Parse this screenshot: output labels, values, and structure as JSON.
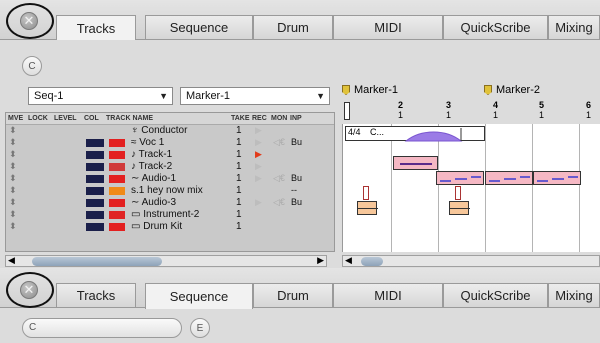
{
  "tabs_top": {
    "items": [
      "Tracks",
      "Sequence",
      "Drum",
      "MIDI",
      "QuickScribe",
      "Mixing"
    ],
    "active": "Tracks",
    "close_glyph": "✕"
  },
  "tabs_bottom": {
    "items": [
      "Tracks",
      "Sequence",
      "Drum",
      "MIDI",
      "QuickScribe",
      "Mixing"
    ],
    "active": "Sequence",
    "close_glyph": "✕"
  },
  "chunks_button": "C",
  "bottom_buttons": {
    "c": "C",
    "e": "E"
  },
  "sequence_select": {
    "value": "Seq-1"
  },
  "marker_select": {
    "value": "Marker-1"
  },
  "markers": [
    {
      "label": "Marker-1"
    },
    {
      "label": "Marker-2"
    }
  ],
  "ruler": [
    {
      "bar": "2",
      "beat": "1"
    },
    {
      "bar": "3",
      "beat": "1"
    },
    {
      "bar": "4",
      "beat": "1"
    },
    {
      "bar": "5",
      "beat": "1"
    },
    {
      "bar": "6",
      "beat": "1"
    }
  ],
  "table": {
    "headers": [
      "MVE",
      "LOCK",
      "LEVEL",
      "COL",
      "TRACK NAME",
      "TAKE",
      "REC",
      "MON",
      "INP"
    ],
    "rows": [
      {
        "name": "Conductor",
        "icon": "conductor-icon",
        "glyph": "♆",
        "take": "1",
        "level": "",
        "color": "",
        "rec": "▶",
        "rec_color": "#bdbdbd",
        "mon": "",
        "inp": ""
      },
      {
        "name": "Voc 1",
        "icon": "audio-wave-icon",
        "glyph": "≈",
        "take": "1",
        "level": "#1a1f4a",
        "color": "#e32020",
        "rec": "▶",
        "rec_color": "#bdbdbd",
        "mon": "◁€",
        "inp": "Bu"
      },
      {
        "name": "Track-1",
        "icon": "midi-note-icon",
        "glyph": "♪",
        "take": "1",
        "level": "#1a1f4a",
        "color": "#e32020",
        "rec": "▶",
        "rec_color": "#e23a1a",
        "mon": "",
        "inp": ""
      },
      {
        "name": "Track-2",
        "icon": "midi-note-icon",
        "glyph": "♪",
        "take": "1",
        "level": "#1a1f4a",
        "color": "#d03a3a",
        "rec": "▶",
        "rec_color": "#bdbdbd",
        "mon": "",
        "inp": ""
      },
      {
        "name": "Audio-1",
        "icon": "audio-wave-icon",
        "glyph": "∼",
        "take": "1",
        "level": "#1a1f4a",
        "color": "#e32020",
        "rec": "▶",
        "rec_color": "#bdbdbd",
        "mon": "◁€",
        "inp": "Bu"
      },
      {
        "name": "hey now mix",
        "icon": "stereo-icon",
        "glyph": "s.1",
        "take": "1",
        "level": "#1a1f4a",
        "color": "#f08a18",
        "rec": "",
        "rec_color": "#bdbdbd",
        "mon": "",
        "inp": "--"
      },
      {
        "name": "Audio-3",
        "icon": "audio-wave-icon",
        "glyph": "∼",
        "take": "1",
        "level": "#1a1f4a",
        "color": "#e32020",
        "rec": "▶",
        "rec_color": "#bdbdbd",
        "mon": "◁€",
        "inp": "Bu"
      },
      {
        "name": "Instrument-2",
        "icon": "instrument-icon",
        "glyph": "▭",
        "take": "1",
        "level": "#1a1f4a",
        "color": "#e02424",
        "rec": "",
        "rec_color": "#bdbdbd",
        "mon": "",
        "inp": ""
      },
      {
        "name": "Drum Kit",
        "icon": "instrument-icon",
        "glyph": "▭",
        "take": "1",
        "level": "#1a1f4a",
        "color": "#e32020",
        "rec": "",
        "rec_color": "#bdbdbd",
        "mon": "",
        "inp": ""
      }
    ]
  },
  "conductor_region": {
    "meter": "4/4",
    "label": "C..."
  }
}
